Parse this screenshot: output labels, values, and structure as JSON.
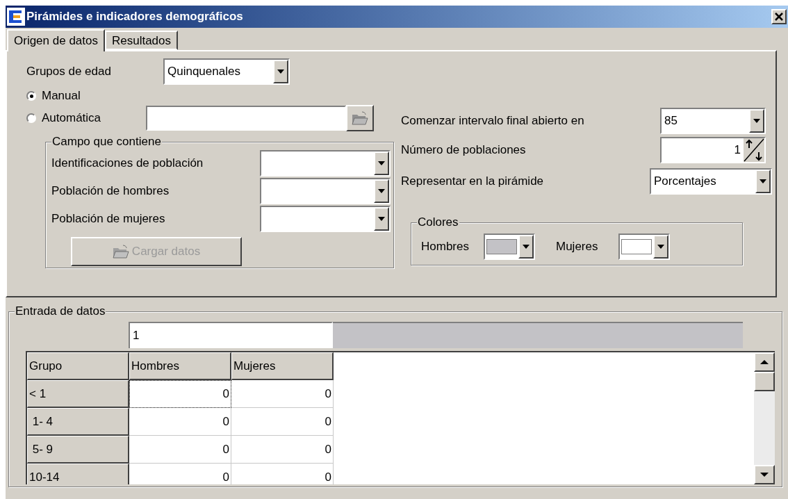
{
  "window": {
    "title": "Pirámides e indicadores demográficos"
  },
  "tabs": [
    {
      "label": "Origen de datos",
      "selected": true
    },
    {
      "label": "Resultados",
      "selected": false
    }
  ],
  "origin": {
    "age_groups": {
      "label": "Grupos de edad",
      "value": "Quinquenales"
    },
    "modes": [
      {
        "label": "Manual",
        "selected": true
      },
      {
        "label": "Automática",
        "selected": false
      }
    ],
    "field_group": {
      "title": "Campo que contiene",
      "fields": [
        {
          "label": "Identificaciones de población"
        },
        {
          "label": "Población de hombres"
        },
        {
          "label": "Población de mujeres"
        }
      ],
      "load_button": {
        "label": "Cargar datos",
        "disabled": true
      }
    },
    "open_interval": {
      "label": "Comenzar intervalo final abierto en",
      "value": "85"
    },
    "populations": {
      "label": "Número de poblaciones",
      "value": "1"
    },
    "represent": {
      "label": "Representar en la pirámide",
      "value": "Porcentajes"
    },
    "colors": {
      "title": "Colores",
      "items": [
        {
          "label": "Hombres",
          "color": "#c3c2c6"
        },
        {
          "label": "Mujeres",
          "color": "#ffffff"
        }
      ]
    }
  },
  "data_entry": {
    "title": "Entrada de datos",
    "population_header": "1",
    "columns": [
      "Grupo",
      "Hombres",
      "Mujeres"
    ],
    "rows": [
      {
        "group": "< 1",
        "cells": [
          {
            "value": "0",
            "focused": true
          },
          {
            "value": "0",
            "focused": false
          }
        ]
      },
      {
        "group": " 1- 4",
        "cells": [
          {
            "value": "0",
            "focused": false
          },
          {
            "value": "0",
            "focused": false
          }
        ]
      },
      {
        "group": " 5- 9",
        "cells": [
          {
            "value": "0",
            "focused": false
          },
          {
            "value": "0",
            "focused": false
          }
        ]
      },
      {
        "group": "10-14",
        "cells": [
          {
            "value": "0",
            "focused": false
          },
          {
            "value": "0",
            "focused": false
          }
        ]
      }
    ]
  }
}
